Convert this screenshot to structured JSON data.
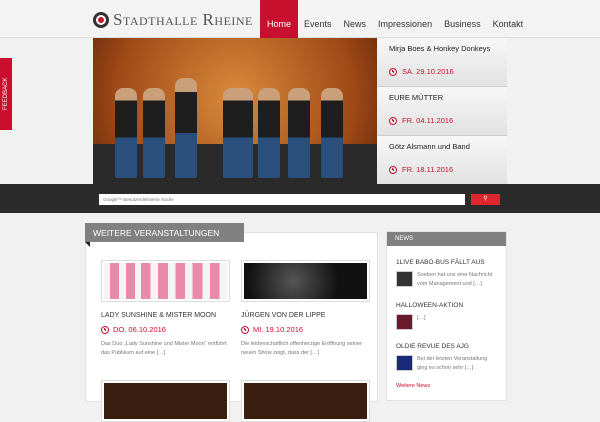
{
  "header": {
    "logo_text": "Stadthalle Rheine",
    "nav": [
      "Home",
      "Events",
      "News",
      "Impressionen",
      "Business",
      "Kontakt"
    ]
  },
  "feedback": "FEEDBACK",
  "hero_events": [
    {
      "title": "Mirja Boes & Honkey Donkeys",
      "date": "SA. 29.10.2016"
    },
    {
      "title": "EURE MÜTTER",
      "date": "FR. 04.11.2016"
    },
    {
      "title": "Götz Alsmann und Band",
      "date": "FR. 18.11.2016"
    }
  ],
  "search": {
    "placeholder": "Google™ Benutzerdefinierte Suche",
    "button_icon": "search-icon"
  },
  "main": {
    "tab": "WEITERE VERANSTALTUNGEN",
    "cards": [
      {
        "title": "LADY SUNSHINE & MISTER MOON",
        "date": "DO. 06.10.2016",
        "desc": "Das Duo „Lady Sunshine und Mister Moon“ entführt das Publikum auf eine […]"
      },
      {
        "title": "JÜRGEN VON DER LIPPE",
        "date": "MI. 19.10.2016",
        "desc": "Die leidenschaftlich offenherzige Eröffnung seiner neuen Show zeigt, dass der […]"
      }
    ]
  },
  "sidebar": {
    "title": "NEWS",
    "items": [
      {
        "title": "1LIVE BABO-BUS FÄLLT AUS",
        "text": "Soeben hat uns eine Nachricht vom Management und […]"
      },
      {
        "title": "HALLOWEEN-AKTION",
        "text": "[…]"
      },
      {
        "title": "OLDIE REVUE DES AJG",
        "text": "Bei der letzten Veranstaltung ging es schon sehr […]"
      }
    ],
    "more": "Weitere News"
  }
}
